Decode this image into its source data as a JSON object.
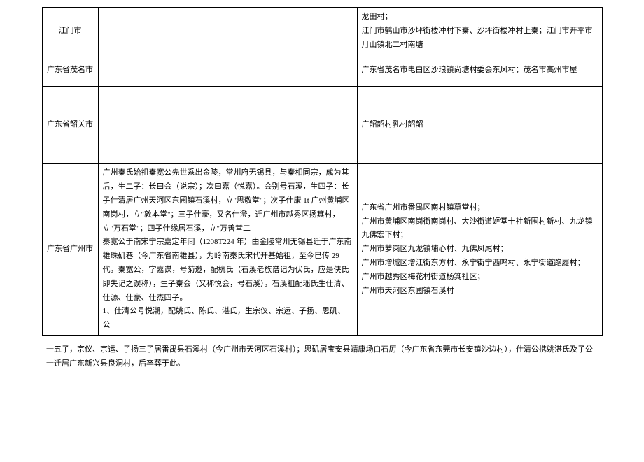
{
  "table": {
    "rows": [
      {
        "region": "江门市",
        "history": "",
        "distribution": "龙田村；\n江门市鹤山市沙坪街楼冲村下秦、沙坪街楼冲村上秦；江门市开平市月山镇北二村南塘"
      },
      {
        "region": "广东省茂名市",
        "history": "",
        "distribution": "广东省茂名市电白区沙琅镇尚塘村委会东风村；茂名市高州市屋"
      },
      {
        "region": "广东省韶关市",
        "history": "",
        "distribution": "广韶韶村乳村韶韶"
      },
      {
        "region": "广东省广州市",
        "history": "广州秦氏始祖秦宽公先世系出金陵，常州府无锡县，与秦相同宗，成为其后，生二子：长曰会（说宗）；次曰嘉（悦嘉）。会别号石溪，生四子：长子仕清居广州天河区东圃镇石溪村，立\"思敬堂\"；次子仕康 1t 广州黄埔区南岗村，立\"敦本堂\"；三子仕豪，又名仕澄，迁广州市越秀区扬箕村，立\"万石堂\"；四子仕缘居石溪，立\"万善堂二\n秦宽公于南宋宁宗嘉定年间（1208T224 年）由金陵常州无锡县迁于广东南雄珠矶巷（今广东省南雄县），为岭南秦氏宋代开基始祖，至今已传 29 代。秦宽公，字嘉谋，号菊邀，配杭氏（石溪老族谱记为伏氏，应是侠氏即失记之误称），生子秦会（又称悦会，号石溪）。石溪祖配瑶氏生仕清、仕源、仕豪、仕杰四子。\n1、仕清公号悦潮，配姚氏、陈氏、湛氏，生宗仪、宗运、子扬、思矶、公",
        "distribution": "广东省广州市番禺区南村镇草堂村；\n广州市黄埔区南岗街南岗村、大沙街道姬堂十社新围村新村、九龙镇九佛宏下村；\n广州市萝岗区九龙镇埔心村、九佛凤尾村；\n广州市增城区增江街东方村、永宁街宁西鸣村、永宁街道跑履村；\n广州市越秀区梅花村街道杨箕社区；\n广州市天河区东圃镇石溪村"
      }
    ]
  },
  "footer": "一五子，宗仪、宗运、子扬三子居番禺县石溪村（今广州市天河区石溪村）；思矶居宝安县靖康场白石厉（今广东省东莞市长安镇沙边村），仕清公携姚湛氏及子公一迁居广东新兴县良洞村，后卒葬于此。"
}
